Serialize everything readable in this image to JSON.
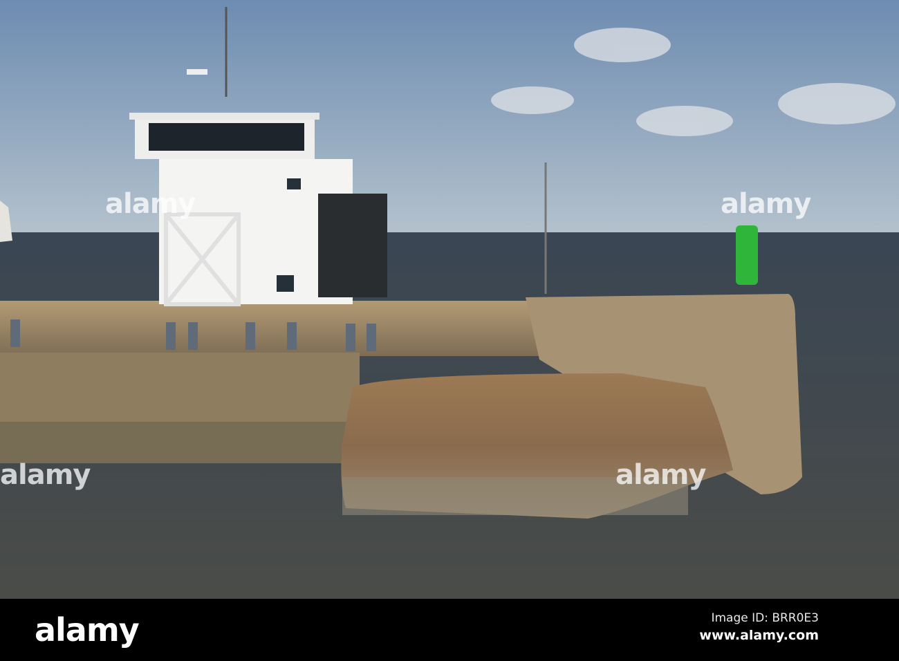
{
  "photo": {
    "subject": "harbour control tower on stone breakwater with green beacon",
    "colors": {
      "sky_top": "#6f8fb4",
      "sky_bottom": "#a9bccd",
      "sea": "#3d4650",
      "stone": "#a88f6c",
      "beacon": "#2fb53a"
    }
  },
  "watermark": {
    "text": "alamy",
    "mark": "a"
  },
  "footer": {
    "logo": "alamy",
    "image_id": "Image ID: BRR0E3",
    "site": "www.alamy.com"
  }
}
